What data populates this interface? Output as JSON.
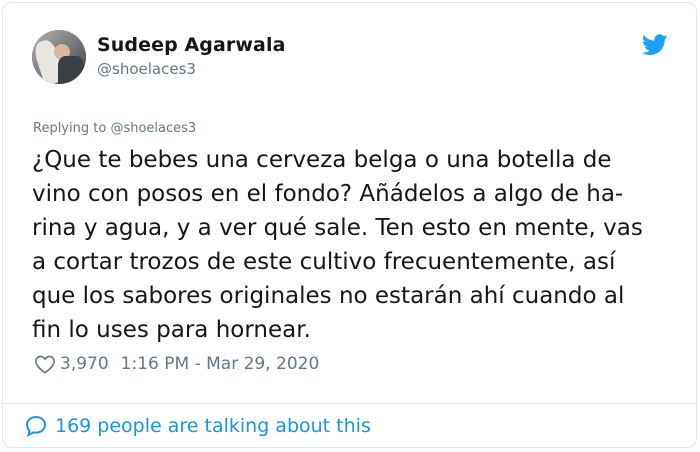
{
  "tweet": {
    "author_name": "Sudeep Agarwala",
    "author_handle": "@shoelaces3",
    "replying_to_label": "Replying to",
    "replying_to_handle": "@shoelaces3",
    "text": "¿Que te bebes una cerveza belga o una botella de\nvino con posos en el fondo? Añádelos a algo de ha-\nrina y agua, y a ver qué sale. Ten esto en mente, vas\na cortar trozos de este cultivo frecuentemente, así\nque los sabores originales no estarán ahí cuando al\nfin lo uses para hornear.",
    "likes": "3,970",
    "time": "1:16 PM - Mar 29, 2020",
    "talking": "169 people are talking about this",
    "icons": {
      "brand": "twitter-bird-icon",
      "like": "heart-icon",
      "talk": "speech-bubble-icon"
    },
    "colors": {
      "brand": "#1da1f2",
      "link": "#1b95e0",
      "muted": "#657786",
      "text": "#14171a",
      "border": "#e1e8ed"
    }
  }
}
